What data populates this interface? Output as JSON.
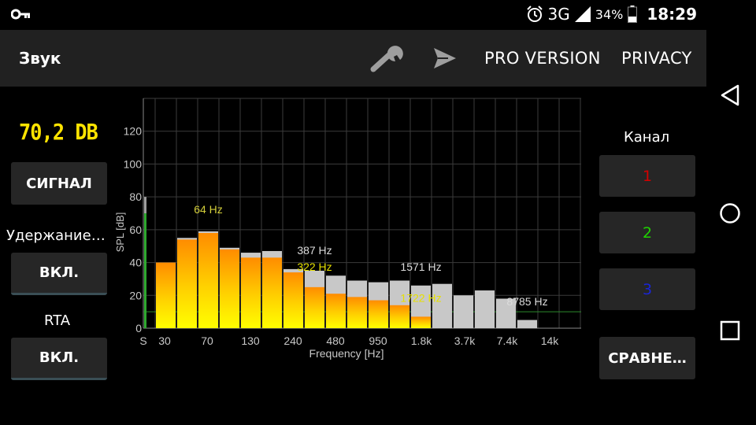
{
  "status_bar": {
    "network": "3G",
    "battery_percent": "34%",
    "time": "18:29"
  },
  "app_bar": {
    "title": "Звук",
    "menu": [
      "PRO VERSION",
      "PRIVACY"
    ],
    "icons": [
      "wrench-icon",
      "send-icon"
    ]
  },
  "left_panel": {
    "level_readout": "70,2 DB",
    "signal_button": "СИГНАЛ",
    "hold_label": "Удержание…",
    "hold_button": "ВКЛ.",
    "rta_label": "RTA",
    "rta_button": "ВКЛ."
  },
  "right_panel": {
    "channel_label": "Канал",
    "channels": [
      {
        "label": "1",
        "color": "#d40000"
      },
      {
        "label": "2",
        "color": "#1fd400"
      },
      {
        "label": "3",
        "color": "#1a25d6"
      }
    ],
    "compare_button": "СРАВНЕ…"
  },
  "chart_data": {
    "type": "bar",
    "xlabel": "Frequency [Hz]",
    "ylabel": "SPL [dB]",
    "ylim": [
      0,
      140
    ],
    "y_ticks": [
      0,
      20,
      40,
      60,
      80,
      100,
      120
    ],
    "x_tick_labels": [
      "S",
      "30",
      "70",
      "130",
      "240",
      "480",
      "950",
      "1.8k",
      "3.7k",
      "7.4k",
      "14k"
    ],
    "grid": true,
    "series": [
      {
        "values": [
          40,
          55,
          59,
          49,
          46,
          47,
          36,
          35,
          32,
          29,
          28,
          29,
          26,
          27,
          20,
          23,
          18,
          5
        ]
      },
      {
        "values": [
          40,
          54,
          58,
          48,
          43,
          43,
          34,
          25,
          21,
          19,
          17,
          14,
          7,
          0,
          0,
          0,
          0,
          0
        ]
      }
    ],
    "s_meter": {
      "value": 80,
      "peak": 70
    },
    "annotations": [
      {
        "text": "64 Hz",
        "bar": 2,
        "y": 70,
        "color": "#d4cf3a"
      },
      {
        "text": "387 Hz",
        "bar": 7,
        "y": 45,
        "color": "#dcdcdc"
      },
      {
        "text": "322 Hz",
        "bar": 7,
        "y": 35,
        "color": "#e6e000"
      },
      {
        "text": "1571 Hz",
        "bar": 12,
        "y": 35,
        "color": "#dcdcdc"
      },
      {
        "text": "1722 Hz",
        "bar": 12,
        "y": 16,
        "color": "#e6e000"
      },
      {
        "text": "8785 Hz",
        "bar": 17,
        "y": 14,
        "color": "#dcdcdc"
      }
    ],
    "reference_line": 10
  },
  "colors": {
    "bar_gray": "#c8c8c8",
    "bar_orange": "#ff8c00",
    "bar_yellow": "#ffff00",
    "readout_yellow": "#ffe400",
    "grid": "#3b3b3b"
  }
}
